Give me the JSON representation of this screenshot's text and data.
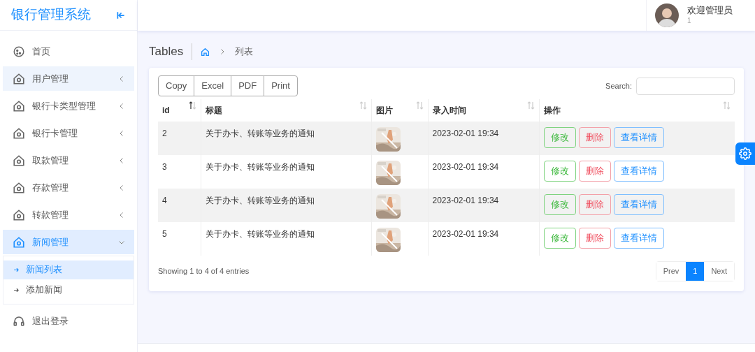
{
  "sidebar": {
    "title": "银行管理系统",
    "items": [
      {
        "label": "首页",
        "kind": "home",
        "highlighted": false,
        "selected": false
      },
      {
        "label": "用户管理",
        "kind": "group",
        "highlighted": true,
        "selected": false,
        "expanded": false
      },
      {
        "label": "银行卡类型管理",
        "kind": "group",
        "highlighted": false,
        "selected": false,
        "expanded": false
      },
      {
        "label": "银行卡管理",
        "kind": "group",
        "highlighted": false,
        "selected": false,
        "expanded": false
      },
      {
        "label": "取款管理",
        "kind": "group",
        "highlighted": false,
        "selected": false,
        "expanded": false
      },
      {
        "label": "存款管理",
        "kind": "group",
        "highlighted": false,
        "selected": false,
        "expanded": false
      },
      {
        "label": "转款管理",
        "kind": "group",
        "highlighted": false,
        "selected": false,
        "expanded": false
      },
      {
        "label": "新闻管理",
        "kind": "group",
        "highlighted": true,
        "selected": true,
        "expanded": true,
        "children": [
          {
            "label": "新闻列表",
            "selected": true
          },
          {
            "label": "添加新闻",
            "selected": false
          }
        ]
      },
      {
        "label": "退出登录",
        "kind": "logout",
        "highlighted": false,
        "selected": false
      }
    ]
  },
  "header": {
    "greeting": "欢迎管理员",
    "user_id": "1"
  },
  "page": {
    "title": "Tables",
    "breadcrumb": "列表"
  },
  "export_buttons": [
    "Copy",
    "Excel",
    "PDF",
    "Print"
  ],
  "search": {
    "label": "Search:"
  },
  "table": {
    "columns": [
      {
        "label": "id",
        "sorted": true
      },
      {
        "label": "标题",
        "sorted": false
      },
      {
        "label": "图片",
        "sorted": false
      },
      {
        "label": "录入时间",
        "sorted": false
      },
      {
        "label": "操作",
        "sorted": false
      }
    ],
    "rows": [
      {
        "id": "2",
        "title": "关于办卡、转账等业务的通知",
        "time": "2023-02-01 19:34",
        "actions": [
          "修改",
          "删除",
          "查看详情"
        ]
      },
      {
        "id": "3",
        "title": "关于办卡、转账等业务的通知",
        "time": "2023-02-01 19:34",
        "actions": [
          "修改",
          "删除",
          "查看详情"
        ]
      },
      {
        "id": "4",
        "title": "关于办卡、转账等业务的通知",
        "time": "2023-02-01 19:34",
        "actions": [
          "修改",
          "删除",
          "查看详情"
        ]
      },
      {
        "id": "5",
        "title": "关于办卡、转账等业务的通知",
        "time": "2023-02-01 19:34",
        "actions": [
          "修改",
          "删除",
          "查看详情"
        ]
      }
    ]
  },
  "info": "Showing 1 to 4 of 4 entries",
  "pagination": [
    {
      "label": "Prev",
      "selected": false
    },
    {
      "label": "1",
      "selected": true
    },
    {
      "label": "Next",
      "selected": false
    }
  ]
}
